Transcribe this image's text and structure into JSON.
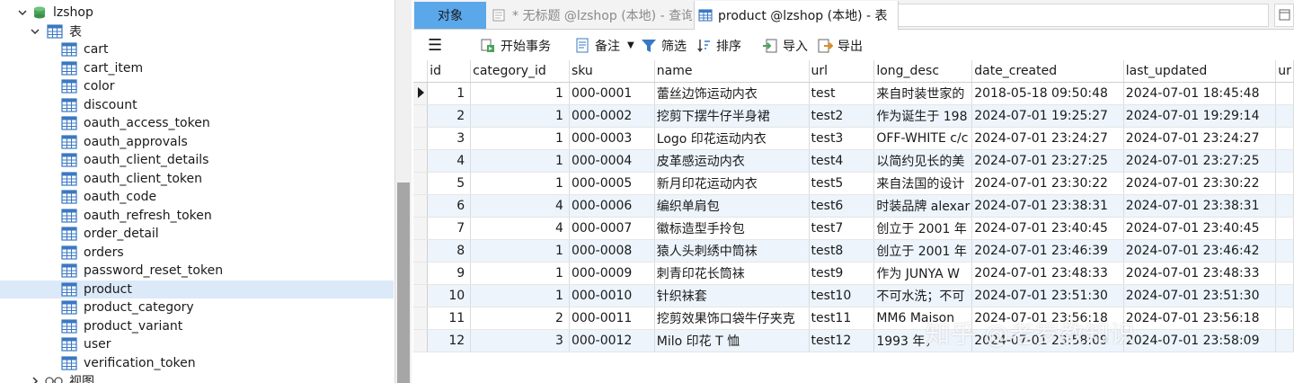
{
  "nav": {
    "database": "lzshop",
    "tables_folder": "表",
    "tables": [
      "cart",
      "cart_item",
      "color",
      "discount",
      "oauth_access_token",
      "oauth_approvals",
      "oauth_client_details",
      "oauth_client_token",
      "oauth_code",
      "oauth_refresh_token",
      "order_detail",
      "orders",
      "password_reset_token",
      "product",
      "product_category",
      "product_variant",
      "user",
      "verification_token"
    ],
    "selected_table": "product",
    "views_folder": "视图"
  },
  "tabs": {
    "objects": "对象",
    "query": "* 无标题 @lzshop (本地) - 查询",
    "active": "product @lzshop (本地) - 表"
  },
  "toolbar": {
    "menu": "☰",
    "begin_transaction": "开始事务",
    "note": "备注",
    "filter": "筛选",
    "sort": "排序",
    "import": "导入",
    "export": "导出"
  },
  "grid": {
    "columns": [
      "id",
      "category_id",
      "sku",
      "name",
      "url",
      "long_desc",
      "date_created",
      "last_updated",
      "ur"
    ],
    "rows": [
      [
        "1",
        "1",
        "000-0001",
        "蕾丝边饰运动内衣",
        "test",
        "来自时装世家的",
        "2018-05-18 09:50:48",
        "2024-07-01 18:45:48"
      ],
      [
        "2",
        "1",
        "000-0002",
        "挖剪下摆牛仔半身裙",
        "test2",
        "作为诞生于 198",
        "2024-07-01 19:25:27",
        "2024-07-01 19:29:14"
      ],
      [
        "3",
        "1",
        "000-0003",
        "Logo 印花运动内衣",
        "test3",
        "OFF-WHITE c/c",
        "2024-07-01 23:24:27",
        "2024-07-01 23:24:27"
      ],
      [
        "4",
        "1",
        "000-0004",
        "皮革感运动内衣",
        "test4",
        "以简约见长的美",
        "2024-07-01 23:27:25",
        "2024-07-01 23:27:25"
      ],
      [
        "5",
        "1",
        "000-0005",
        "新月印花运动内衣",
        "test5",
        "来自法国的设计",
        "2024-07-01 23:30:22",
        "2024-07-01 23:30:22"
      ],
      [
        "6",
        "4",
        "000-0006",
        "编织单肩包",
        "test6",
        "时装品牌 alexar",
        "2024-07-01 23:38:31",
        "2024-07-01 23:38:31"
      ],
      [
        "7",
        "4",
        "000-0007",
        "徽标造型手拎包",
        "test7",
        "创立于 2001 年",
        "2024-07-01 23:40:45",
        "2024-07-01 23:40:45"
      ],
      [
        "8",
        "1",
        "000-0008",
        "猿人头刺绣中筒袜",
        "test8",
        "创立于 2001 年",
        "2024-07-01 23:46:39",
        "2024-07-01 23:46:42"
      ],
      [
        "9",
        "1",
        "000-0009",
        "刺青印花长筒袜",
        "test9",
        "作为 JUNYA W",
        "2024-07-01 23:48:33",
        "2024-07-01 23:48:33"
      ],
      [
        "10",
        "1",
        "000-0010",
        "针织袜套",
        "test10",
        "不可水洗；不可",
        "2024-07-01 23:51:30",
        "2024-07-01 23:51:30"
      ],
      [
        "11",
        "2",
        "000-0011",
        "挖剪效果饰口袋牛仔夹克",
        "test11",
        "MM6 Maison",
        "2024-07-01 23:56:18",
        "2024-07-01 23:56:18"
      ],
      [
        "12",
        "3",
        "000-0012",
        "Milo 印花 T 恤",
        "test12",
        "1993 年，",
        "2024-07-01 23:58:09",
        "2024-07-01 23:58:09"
      ]
    ]
  },
  "watermark": "知乎 @老罗教知识"
}
